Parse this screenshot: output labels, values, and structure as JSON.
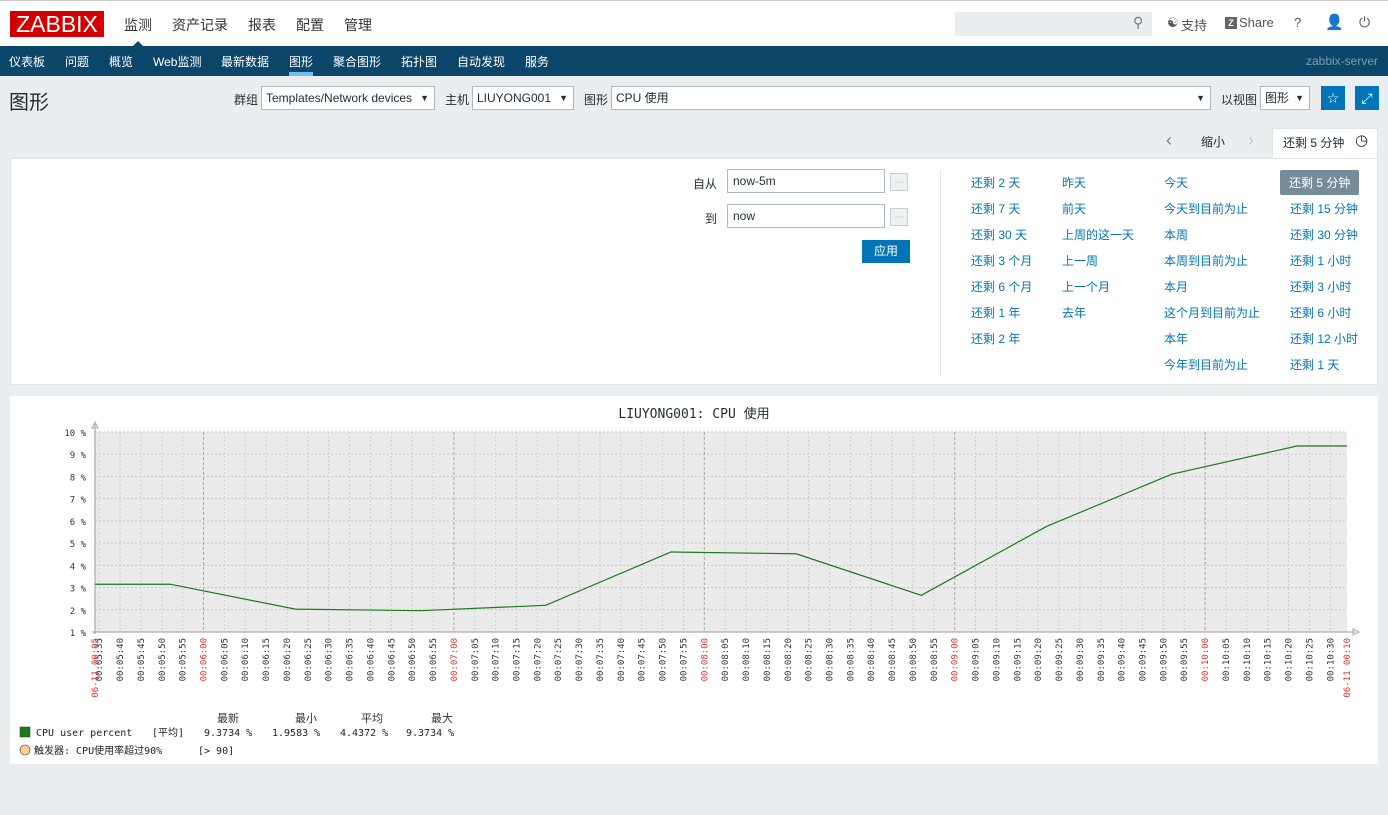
{
  "header": {
    "logo": "ZABBIX",
    "menu": [
      "监测",
      "资产记录",
      "报表",
      "配置",
      "管理"
    ],
    "search_placeholder": "",
    "support": "支持",
    "share": "Share",
    "help": "?"
  },
  "nav": {
    "items": [
      "仪表板",
      "问题",
      "概览",
      "Web监测",
      "最新数据",
      "图形",
      "聚合图形",
      "拓扑图",
      "自动发现",
      "服务"
    ],
    "active": "图形",
    "server": "zabbix-server"
  },
  "page": {
    "title": "图形",
    "group_label": "群组",
    "group_value": "Templates/Network devices",
    "host_label": "主机",
    "host_value": "LIUYONG001",
    "graph_label": "图形",
    "graph_value": "CPU 使用",
    "view_label": "以视图",
    "view_value": "图形"
  },
  "timebar": {
    "zoom_out": "缩小",
    "current": "还剩 5 分钟"
  },
  "filter": {
    "from_label": "自从",
    "from_value": "now-5m",
    "to_label": "到",
    "to_value": "now",
    "apply": "应用",
    "quick": [
      [
        "还剩 2 天",
        "还剩 7 天",
        "还剩 30 天",
        "还剩 3 个月",
        "还剩 6 个月",
        "还剩 1 年",
        "还剩 2 年"
      ],
      [
        "昨天",
        "前天",
        "上周的这一天",
        "上一周",
        "上一个月",
        "去年"
      ],
      [
        "今天",
        "今天到目前为止",
        "本周",
        "本周到目前为止",
        "本月",
        "这个月到目前为止",
        "本年",
        "今年到目前为止"
      ],
      [
        "还剩 5 分钟",
        "还剩 15 分钟",
        "还剩 30 分钟",
        "还剩 1 小时",
        "还剩 3 小时",
        "还剩 6 小时",
        "还剩 12 小时",
        "还剩 1 天"
      ]
    ],
    "selected": "还剩 5 分钟"
  },
  "colors": {
    "accent": "#0275b8",
    "nav": "#0b466a",
    "logo": "#d40000",
    "series": "#1a7c1a",
    "trigger": "#ffd38f",
    "minute_label": "#e03030"
  },
  "chart_data": {
    "type": "line",
    "title": "LIUYONG001: CPU 使用",
    "ylim": [
      1,
      10
    ],
    "yticks": [
      "10 %",
      "9 %",
      "8 %",
      "7 %",
      "6 %",
      "5 %",
      "4 %",
      "3 %",
      "2 %",
      "1 %"
    ],
    "xrange": [
      "00:05:34",
      "00:10:34"
    ],
    "xstart_label": "06-11 00:05",
    "xend_label": "06-11 00:10",
    "grid": true,
    "series": [
      {
        "name": "CPU user percent",
        "x": [
          "00:05:34",
          "00:05:52",
          "00:06:22",
          "00:06:52",
          "00:07:22",
          "00:07:52",
          "00:08:22",
          "00:08:52",
          "00:09:22",
          "00:09:52",
          "00:10:22",
          "00:10:34"
        ],
        "values": [
          3.15,
          3.15,
          2.03,
          1.96,
          2.2,
          4.6,
          4.52,
          2.65,
          5.75,
          8.1,
          9.37,
          9.37
        ]
      }
    ],
    "legend": {
      "headers": [
        "最新",
        "最小",
        "平均",
        "最大"
      ],
      "func": "[平均]",
      "last": "9.3734 %",
      "min": "1.9583 %",
      "avg": "4.4372 %",
      "max": "9.3734 %",
      "trigger": "触发器: CPU使用率超过90%",
      "trigger_cond": "[> 90]"
    }
  }
}
